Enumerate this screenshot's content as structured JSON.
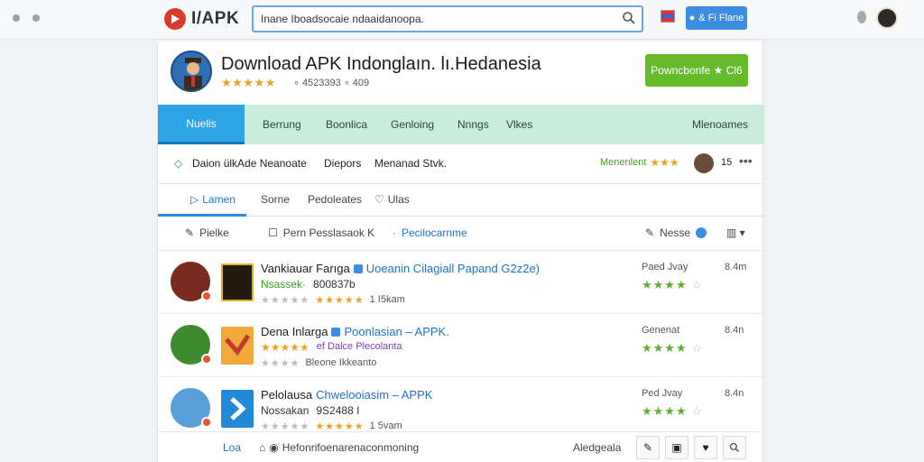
{
  "brand": {
    "name": "I/APK"
  },
  "search": {
    "value": "Inane Iboadsocaie ndaaidanoopa."
  },
  "signin": {
    "label": "& Fi Flane"
  },
  "app": {
    "title": "Download APK Indonglaın. lı.Hedanesia",
    "stars": "★★★★★",
    "downloads": "∘ 4523393 ∘ 409",
    "download_button": "Powncbonfe ★ Cl6"
  },
  "nav": {
    "tabs": [
      "Nuelis",
      "Berrung",
      "Boonlica",
      "Genloing",
      "Nnngs",
      "Vlkes"
    ],
    "right": "Mlenoames"
  },
  "subbar": {
    "left": "Daion ülkAde Neanoate",
    "middle1": "Diepors",
    "middle2": "Menanad Stvk.",
    "rating_label": "Menenlent",
    "rating_stars": "★★★",
    "count": "15",
    "more": "•••"
  },
  "tabs2": {
    "items": [
      "Lamen",
      "Sorne",
      "Pedoleates",
      "Ulas"
    ]
  },
  "filters": {
    "left": "Pielke",
    "middle": "Pern Pesslasaok K",
    "link": "Pecilocarnme",
    "right": "Nesse"
  },
  "rows": [
    {
      "title": "Vankiauar Farıga",
      "tag": "Uoeanin Cilagiall Papand G2z2e)",
      "sub_green": "Nsassek·",
      "sub_dark": "800837b",
      "sub_extra": "",
      "meta_stars_gray": "★★★★★",
      "meta_stars": "★★★★★",
      "meta_text": "1 I5kam",
      "right_label": "Paed Jvay",
      "right_stars": "★★★★",
      "right_star_empty": "☆",
      "size": "8.4m"
    },
    {
      "title": "Dena Inlarga",
      "tag": "Poonlasian – APPK.",
      "sub_green": "★★★★★",
      "sub_dark": "",
      "sub_extra": "ef Dalce Plecolanta",
      "meta_stars_gray": "★★★★",
      "meta_stars": "",
      "meta_text": "Bleone Ikkeanto",
      "right_label": "Genenat",
      "right_stars": "★★★★",
      "right_star_empty": "☆",
      "size": "8.4n"
    },
    {
      "title": "Pelolausa",
      "tag": "Chwelooiasim – APPK",
      "sub_green": "Nossakan",
      "sub_dark": "9S2488  I",
      "sub_extra": "",
      "meta_stars_gray": "★★★★★",
      "meta_stars": "★★★★★",
      "meta_text": "1 5vam",
      "right_label": "Ped Jvay",
      "right_stars": "★★★★",
      "right_star_empty": "☆",
      "size": "8.4n"
    }
  ],
  "footer": {
    "left": "Loa",
    "middle": "Hefonrifoenarenaconmoning",
    "right": "Aledgeala"
  },
  "colors": {
    "accent_blue": "#2ea3e6",
    "download_green": "#66bb2a",
    "nav_bg": "#c9ecdc"
  }
}
